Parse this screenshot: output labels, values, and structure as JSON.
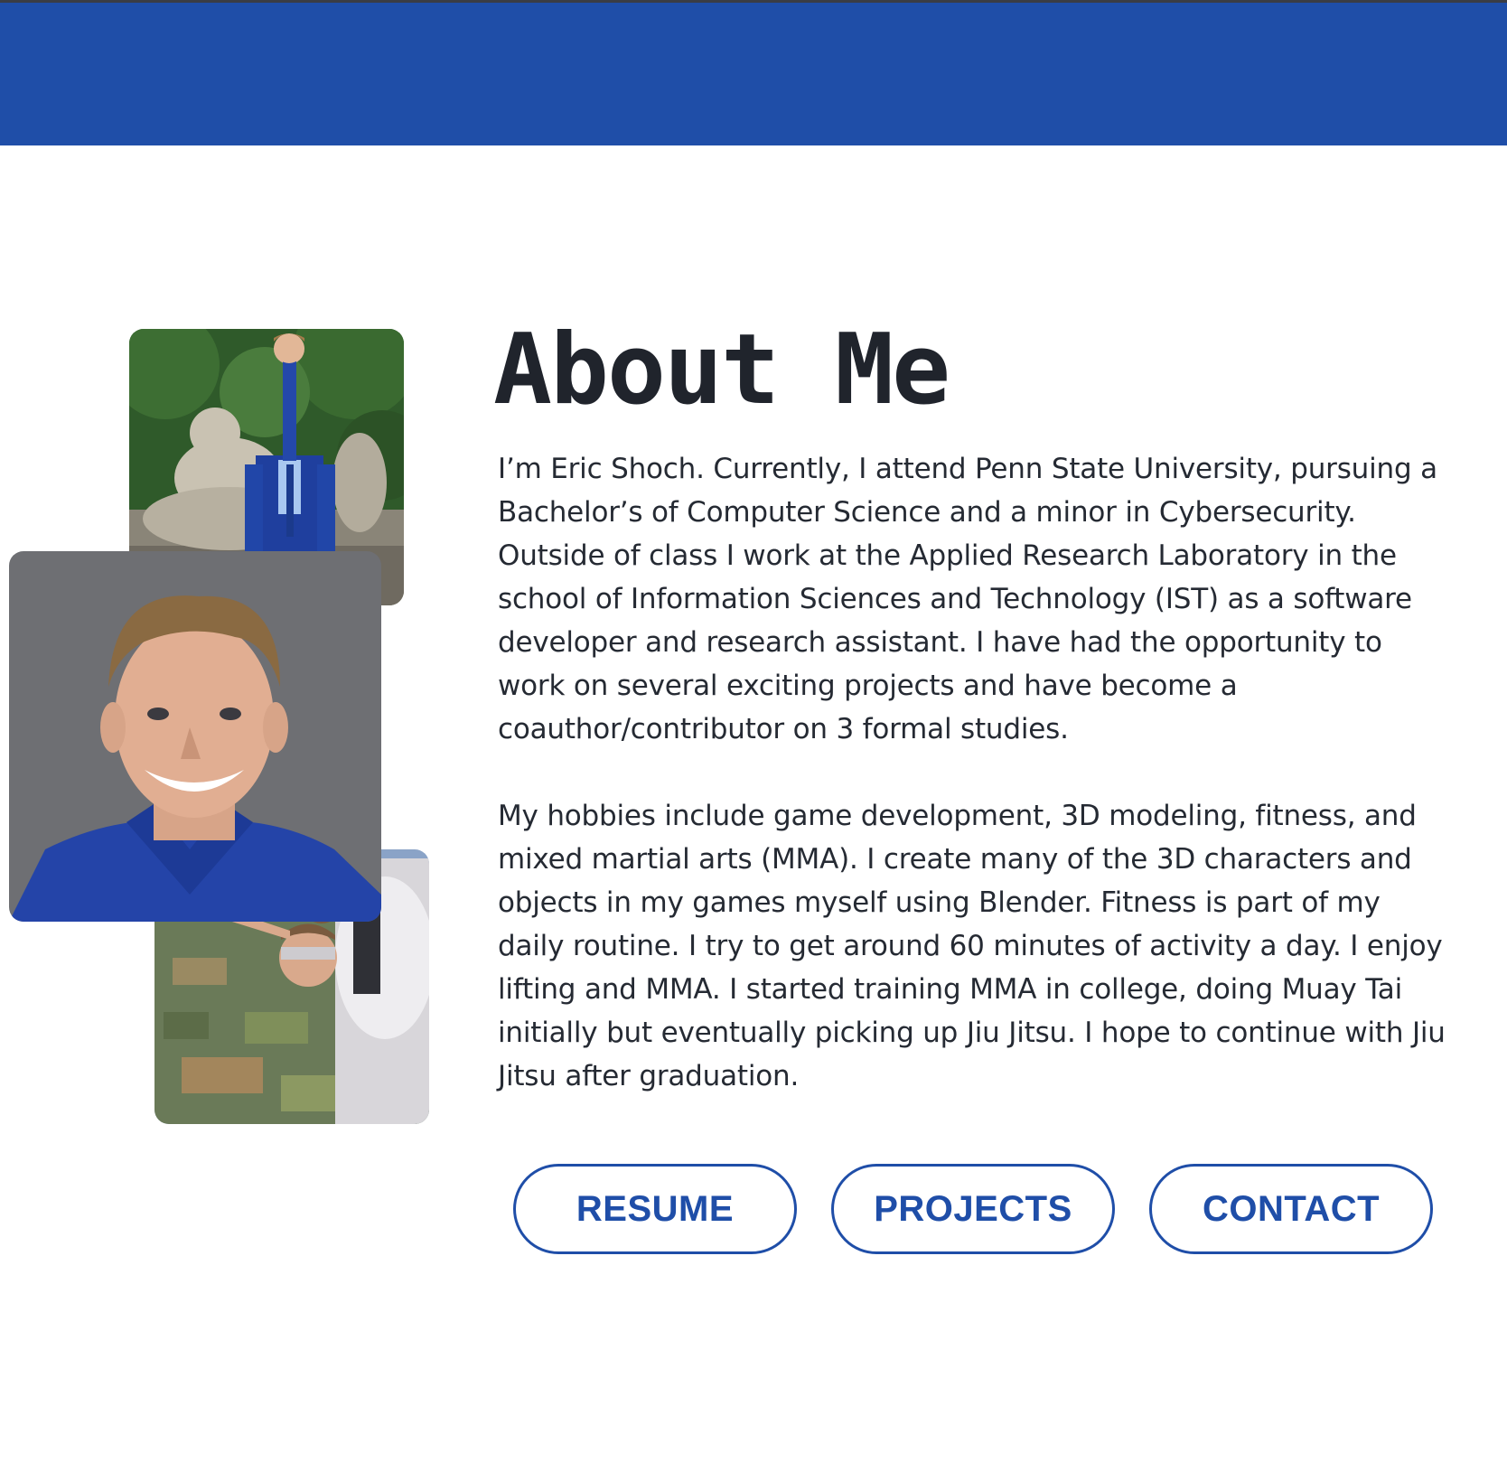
{
  "about": {
    "title": "About Me",
    "bio_paragraphs": [
      "I’m Eric Shoch. Currently, I attend Penn State University, pursuing a Bachelor’s of Computer Science and a minor in Cybersecurity. Outside of class I work at the Applied Research Laboratory in the school of Information Sciences and Technology (IST) as a software developer and research assistant. I have had the opportunity to work on several exciting projects and have become a coauthor/contributor on 3 formal studies.",
      "My hobbies include game development, 3D modeling, fitness, and mixed martial arts (MMA). I create many of the 3D characters and objects in my games myself using Blender. Fitness is part of my daily routine. I try to get around 60 minutes of activity a day. I enjoy lifting and MMA. I started training MMA in college, doing Muay Tai initially but eventually picking up Jiu Jitsu. I hope to continue with Jiu Jitsu after graduation."
    ]
  },
  "buttons": {
    "resume": "RESUME",
    "projects": "PROJECTS",
    "contact": "CONTACT"
  },
  "colors": {
    "header": "#1f4ea8",
    "accent": "#1f4ea8",
    "text": "#252a33"
  }
}
